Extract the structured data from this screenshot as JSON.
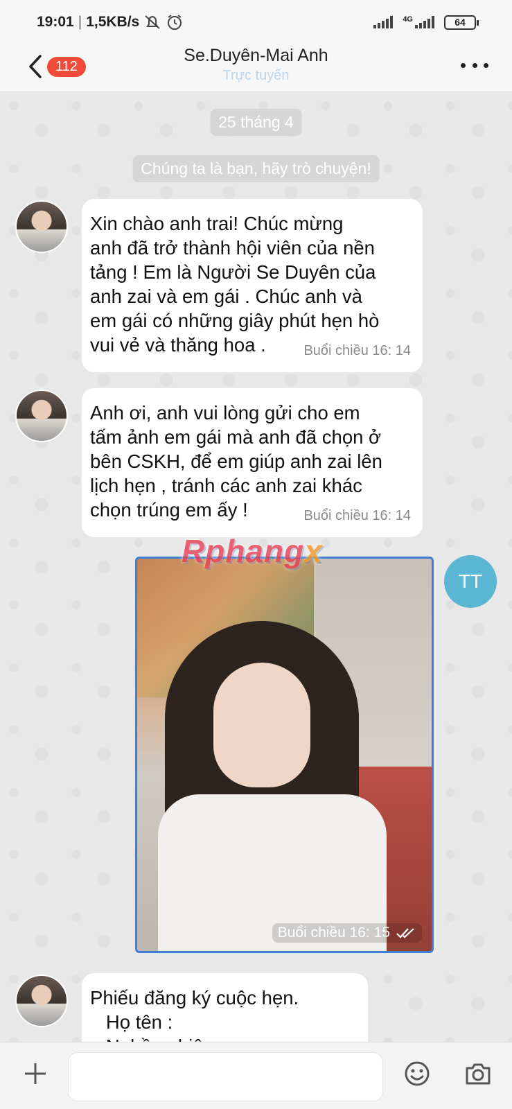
{
  "status_bar": {
    "time": "19:01",
    "separator": "|",
    "net_speed": "1,5KB/s",
    "network_type": "4G",
    "battery": "64",
    "icons": [
      "mute-bell-icon",
      "alarm-icon",
      "signal-icon",
      "signal-4g-icon",
      "battery-icon"
    ]
  },
  "header": {
    "unread_count": "112",
    "title": "Se.Duyên-Mai Anh",
    "status": "Trực tuyến",
    "icons": [
      "back-chevron-icon",
      "more-dots-icon"
    ]
  },
  "chat": {
    "date_chip": "25 tháng 4",
    "system_notice": "Chúng ta là bạn, hãy trò chuyện!",
    "messages": [
      {
        "sender": "contact",
        "text": "Xin chào anh trai! Chúc mừng\nanh đã trở thành hội viên của nền\ntảng ! Em là Người Se Duyên của\nanh zai và em gái . Chúc anh và\nem gái có những giây phút hẹn hò\nvui vẻ và thăng hoa .",
        "time": "Buổi chiều  16: 14"
      },
      {
        "sender": "contact",
        "text": "Anh ơi, anh vui lòng gửi cho em\ntấm ảnh em gái mà anh đã chọn ở\nbên CSKH, để em giúp anh zai lên\nlịch hẹn , tránh các anh zai khác\nchọn trúng em ấy !",
        "time": "Buổi chiều  16: 14"
      },
      {
        "sender": "me",
        "type": "image",
        "avatar_initials": "TT",
        "time": "Buổi chiều  16: 15",
        "watermark": "Rphangx"
      },
      {
        "sender": "contact",
        "text": "Phiếu đăng ký cuộc hẹn.\n   Họ tên :\n   Nghề nghiệp :"
      }
    ]
  },
  "input_bar": {
    "placeholder": "",
    "icons": [
      "plus-icon",
      "emoji-icon",
      "camera-icon"
    ]
  }
}
